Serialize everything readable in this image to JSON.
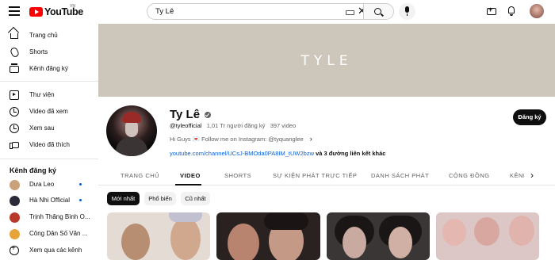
{
  "header": {
    "logo_text": "YouTube",
    "country_code": "VN",
    "search_value": "Ty Lê"
  },
  "sidebar": {
    "items": [
      {
        "label": "Trang chủ",
        "icon": "home-icon"
      },
      {
        "label": "Shorts",
        "icon": "shorts-icon"
      },
      {
        "label": "Kênh đăng ký",
        "icon": "subscriptions-icon"
      },
      {
        "label": "Thư viện",
        "icon": "library-icon"
      },
      {
        "label": "Video đã xem",
        "icon": "history-icon"
      },
      {
        "label": "Xem sau",
        "icon": "watch-later-icon"
      },
      {
        "label": "Video đã thích",
        "icon": "liked-videos-icon"
      }
    ],
    "subscriptions_heading": "Kênh đăng ký",
    "subscriptions": [
      {
        "label": "Dưa Leo",
        "new": true,
        "color": "#c9a17a"
      },
      {
        "label": "Hà Nhi Official",
        "new": true,
        "color": "#2a2a3a"
      },
      {
        "label": "Trịnh Thăng Bình O...",
        "new": false,
        "color": "#b83a2a"
      },
      {
        "label": "Công Dân Số Văn ...",
        "new": false,
        "color": "#e8a23a"
      }
    ],
    "browse_label": "Xem qua các kênh"
  },
  "banner": {
    "text": "TYLE",
    "color": "#cdc6bb"
  },
  "channel": {
    "name": "Ty Lê",
    "handle": "@tyleofficial",
    "subscribers": "1,01 Tr người đăng ký",
    "videos": "397 video",
    "description": "Hi Guys 💌 Follow me on Instagram: @tyquanglee",
    "link": "youtube.com/channel/UCsJ-BMOda0PA8IM_tUW2bzw",
    "more_links": "và 3 đường liên kết khác",
    "subscribe_label": "Đăng ký"
  },
  "tabs": [
    {
      "label": "TRANG CHỦ",
      "active": false
    },
    {
      "label": "VIDEO",
      "active": true
    },
    {
      "label": "SHORTS",
      "active": false
    },
    {
      "label": "SỰ KIỆN PHÁT TRỰC TIẾP",
      "active": false
    },
    {
      "label": "DANH SÁCH PHÁT",
      "active": false
    },
    {
      "label": "CỘNG ĐỒNG",
      "active": false
    },
    {
      "label": "KÊNH",
      "active": false
    }
  ],
  "filters": [
    {
      "label": "Mới nhất",
      "active": true
    },
    {
      "label": "Phổ biến",
      "active": false
    },
    {
      "label": "Cũ nhất",
      "active": false
    }
  ],
  "videos": [
    {
      "bg": "#d8d2cc"
    },
    {
      "bg": "#2a2220"
    },
    {
      "bg": "#3a3636"
    },
    {
      "bg": "#d9c4c4"
    }
  ]
}
